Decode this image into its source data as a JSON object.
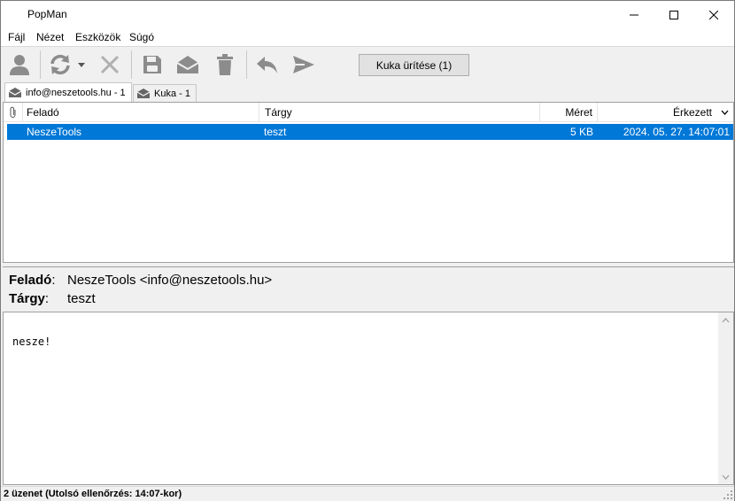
{
  "window": {
    "title": "PopMan"
  },
  "menu": [
    "Fájl",
    "Nézet",
    "Eszközök",
    "Súgó"
  ],
  "toolbar": {
    "icons": [
      "user-icon",
      "refresh-icon",
      "dropdown-arrow-icon",
      "cancel-icon",
      "save-icon",
      "open-envelope-icon",
      "trash-icon",
      "reply-icon",
      "send-icon"
    ],
    "empty_trash_label": "Kuka ürítése (1)"
  },
  "tabs": [
    {
      "label": "info@neszetools.hu - 1",
      "icon": "mail-icon",
      "active": true
    },
    {
      "label": "Kuka - 1",
      "icon": "mail-icon",
      "active": false
    }
  ],
  "list": {
    "columns": {
      "attach": "paperclip-icon",
      "from": "Feladó",
      "subject": "Tárgy",
      "size": "Méret",
      "received": "Érkezett"
    },
    "rows": [
      {
        "from": "NeszeTools",
        "subject": "teszt",
        "size": "5 KB",
        "received": "2024. 05. 27. 14:07:01",
        "selected": true
      }
    ]
  },
  "message": {
    "from_label": "Feladó",
    "from_value": "NeszeTools <info@neszetools.hu>",
    "subject_label": "Tárgy",
    "subject_value": "teszt",
    "body": "nesze!"
  },
  "status": {
    "text": "2 üzenet (Utolsó ellenőrzés: 14:07-kor)"
  },
  "colors": {
    "selection": "#0078d7",
    "icon": "#8c8c8c"
  }
}
